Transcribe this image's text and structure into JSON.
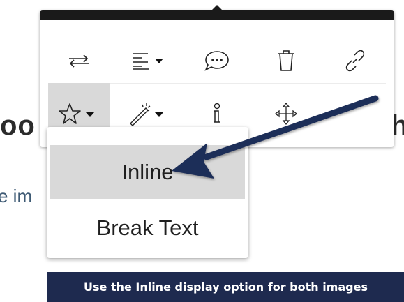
{
  "background": {
    "heading_left": "oo",
    "heading_right": "h",
    "paragraph_fragment": "e im"
  },
  "toolbar": {
    "row1": [
      {
        "icon": "replace-image-icon"
      },
      {
        "icon": "align-dropdown-icon"
      },
      {
        "icon": "caption-comment-icon"
      },
      {
        "icon": "delete-trash-icon"
      },
      {
        "icon": "link-icon"
      }
    ],
    "row2": [
      {
        "icon": "star-display-dropdown-icon",
        "active": true
      },
      {
        "icon": "magic-wand-dropdown-icon"
      },
      {
        "icon": "alt-text-info-icon"
      },
      {
        "icon": "move-arrows-icon"
      }
    ]
  },
  "dropdown": {
    "items": [
      {
        "label": "Inline",
        "selected": true
      },
      {
        "label": "Break Text",
        "selected": false
      }
    ]
  },
  "caption": {
    "text": "Use the Inline display option for both images"
  },
  "colors": {
    "caption_bg": "#1e2a4f",
    "arrow": "#1f2d58",
    "active_bg": "#d9d9d9",
    "toolbar_top": "#1a1a1a"
  }
}
